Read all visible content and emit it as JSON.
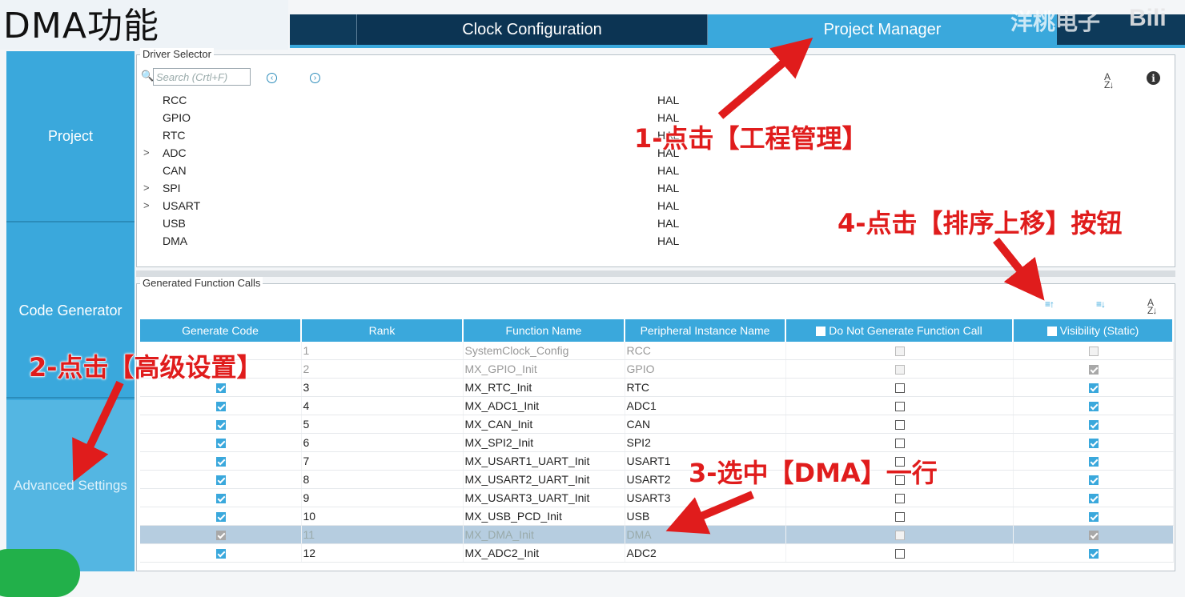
{
  "overlay_title": "DMA功能",
  "watermark": "洋桃电子",
  "watermark_logo": "Bili",
  "tabs": [
    "",
    "Clock Configuration",
    "Project Manager",
    ""
  ],
  "nav": {
    "project": "Project",
    "code_generator": "Code Generator",
    "advanced_settings": "Advanced Settings"
  },
  "driver_selector": {
    "legend": "Driver Selector",
    "search_placeholder": "Search (Crtl+F)",
    "rows": [
      {
        "expand": "",
        "name": "RCC",
        "lib": "HAL"
      },
      {
        "expand": "",
        "name": "GPIO",
        "lib": "HAL"
      },
      {
        "expand": "",
        "name": "RTC",
        "lib": "HAL"
      },
      {
        "expand": ">",
        "name": "ADC",
        "lib": "HAL"
      },
      {
        "expand": "",
        "name": "CAN",
        "lib": "HAL"
      },
      {
        "expand": ">",
        "name": "SPI",
        "lib": "HAL"
      },
      {
        "expand": ">",
        "name": "USART",
        "lib": "HAL"
      },
      {
        "expand": "",
        "name": "USB",
        "lib": "HAL"
      },
      {
        "expand": "",
        "name": "DMA",
        "lib": "HAL"
      }
    ]
  },
  "generated_calls": {
    "legend": "Generated Function Calls",
    "headers": [
      "Generate Code",
      "Rank",
      "Function Name",
      "Peripheral Instance Name",
      "Do Not Generate Function Call",
      "Visibility (Static)"
    ],
    "rows": [
      {
        "gen": "none",
        "rank": "1",
        "fn": "SystemClock_Config",
        "inst": "RCC",
        "dng": "gray",
        "vis": "gray",
        "state": "dim"
      },
      {
        "gen": "none",
        "rank": "2",
        "fn": "MX_GPIO_Init",
        "inst": "GPIO",
        "dng": "gray",
        "vis": "gray-checked",
        "state": "dim"
      },
      {
        "gen": "checked",
        "rank": "3",
        "fn": "MX_RTC_Init",
        "inst": "RTC",
        "dng": "empty",
        "vis": "checked",
        "state": ""
      },
      {
        "gen": "checked",
        "rank": "4",
        "fn": "MX_ADC1_Init",
        "inst": "ADC1",
        "dng": "empty",
        "vis": "checked",
        "state": ""
      },
      {
        "gen": "checked",
        "rank": "5",
        "fn": "MX_CAN_Init",
        "inst": "CAN",
        "dng": "empty",
        "vis": "checked",
        "state": ""
      },
      {
        "gen": "checked",
        "rank": "6",
        "fn": "MX_SPI2_Init",
        "inst": "SPI2",
        "dng": "empty",
        "vis": "checked",
        "state": ""
      },
      {
        "gen": "checked",
        "rank": "7",
        "fn": "MX_USART1_UART_Init",
        "inst": "USART1",
        "dng": "empty",
        "vis": "checked",
        "state": ""
      },
      {
        "gen": "checked",
        "rank": "8",
        "fn": "MX_USART2_UART_Init",
        "inst": "USART2",
        "dng": "empty",
        "vis": "checked",
        "state": ""
      },
      {
        "gen": "checked",
        "rank": "9",
        "fn": "MX_USART3_UART_Init",
        "inst": "USART3",
        "dng": "empty",
        "vis": "checked",
        "state": ""
      },
      {
        "gen": "checked",
        "rank": "10",
        "fn": "MX_USB_PCD_Init",
        "inst": "USB",
        "dng": "empty",
        "vis": "checked",
        "state": ""
      },
      {
        "gen": "gray-checked",
        "rank": "11",
        "fn": "MX_DMA_Init",
        "inst": "DMA",
        "dng": "gray",
        "vis": "gray-checked",
        "state": "sel"
      },
      {
        "gen": "checked",
        "rank": "12",
        "fn": "MX_ADC2_Init",
        "inst": "ADC2",
        "dng": "empty",
        "vis": "checked",
        "state": ""
      }
    ]
  },
  "annotations": {
    "step1": "1-点击【工程管理】",
    "step2": "2-点击【高级设置】",
    "step3": "3-选中【DMA】一行",
    "step4": "4-点击【排序上移】按钮"
  },
  "colors": {
    "accent": "#3aa8dc",
    "dark_nav": "#0e3a5a",
    "annotation": "#e01c1c",
    "selected_row": "#b6cde0"
  }
}
